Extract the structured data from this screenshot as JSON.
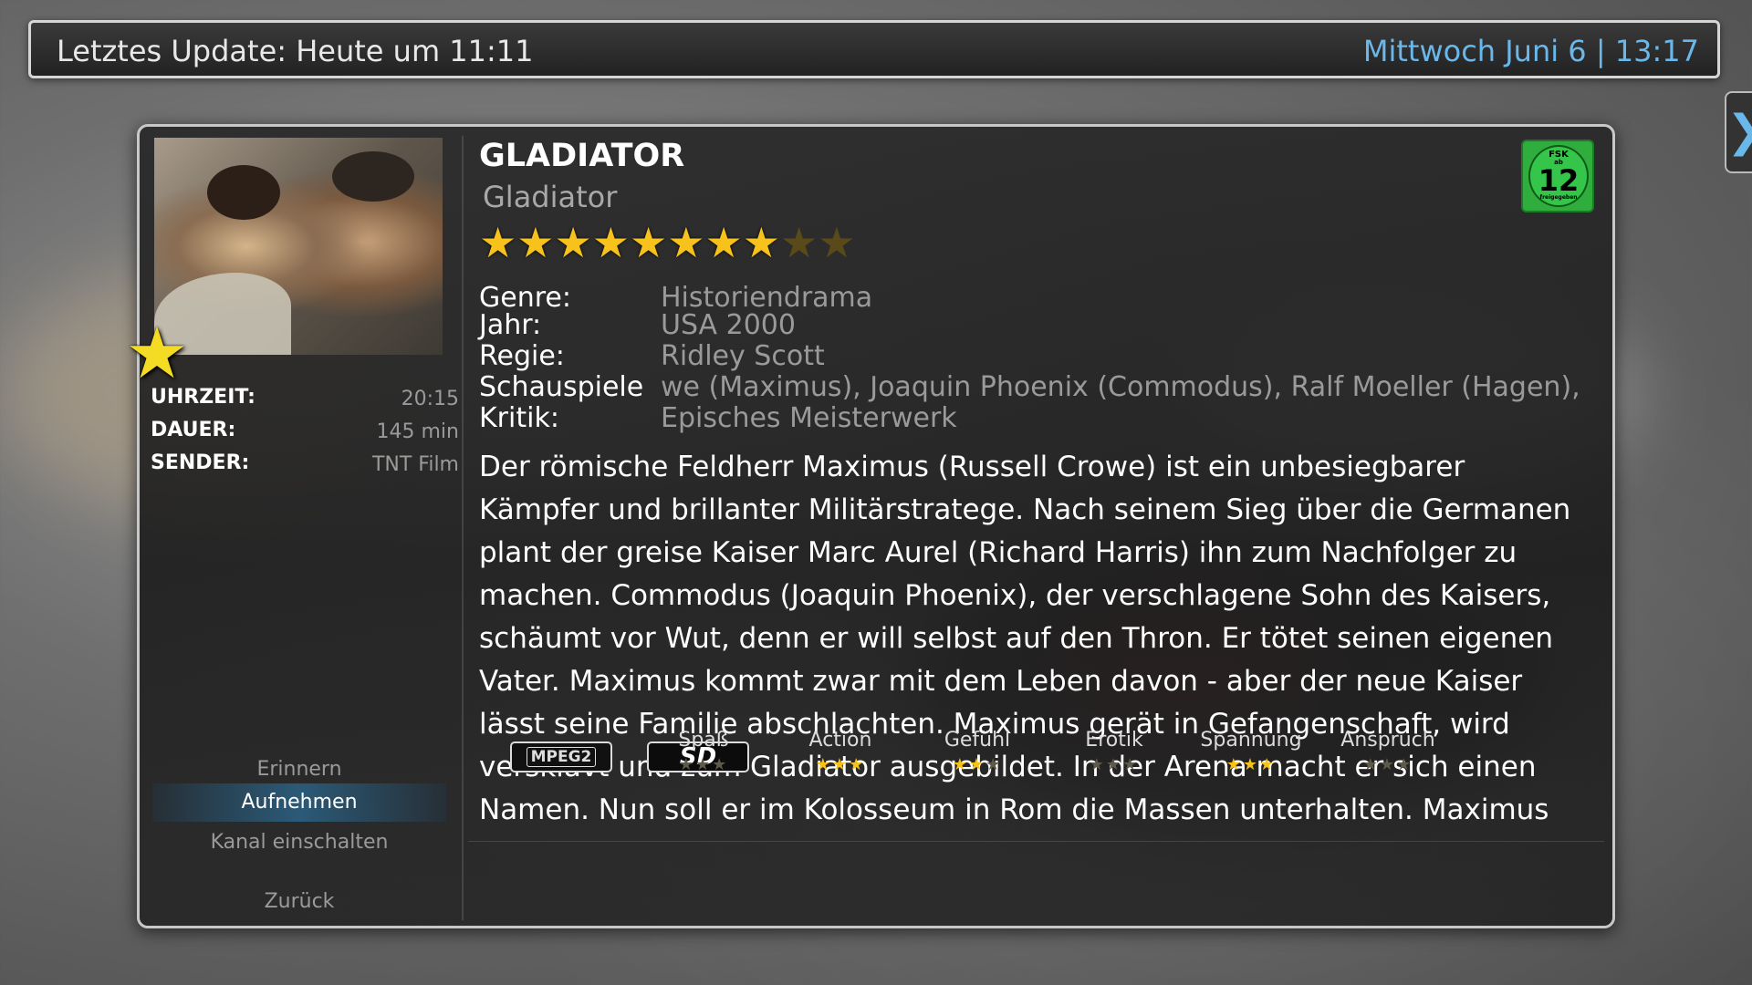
{
  "header": {
    "last_update": "Letztes Update: Heute um 11:11",
    "datetime": "Mittwoch Juni 6 | 13:17"
  },
  "side_tab": {
    "glyph": "❯"
  },
  "movie": {
    "title": "GLADIATOR",
    "original_title": "Gladiator",
    "stars_filled": 8,
    "stars_total": 10,
    "fsk": {
      "top": "FSK",
      "ab": "ab",
      "age": "12",
      "bottom": "freigegeben"
    }
  },
  "broadcast": {
    "time_label": "UHRZEIT:",
    "time_value": "20:15",
    "duration_label": "DAUER:",
    "duration_value": "145 min",
    "channel_label": "SENDER:",
    "channel_value": "TNT Film"
  },
  "meta": {
    "genre_label": "Genre:",
    "genre_value": "Historiendrama",
    "year_label": "Jahr:",
    "year_value": "USA 2000",
    "director_label": "Regie:",
    "director_value": "Ridley Scott",
    "cast_label": "Schauspiele",
    "cast_value": "we (Maximus), Joaquin Phoenix (Commodus), Ralf Moeller (Hagen),",
    "critic_label": "Kritik:",
    "critic_value": "Episches Meisterwerk"
  },
  "description": "Der römische Feldherr Maximus (Russell Crowe) ist ein unbesiegbarer Kämpfer und brillanter Militärstratege. Nach seinem Sieg über die Germanen plant der greise Kaiser Marc Aurel (Richard Harris) ihn zum Nachfolger zu machen. Commodus (Joaquin Phoenix), der verschlagene Sohn des Kaisers, schäumt vor Wut, denn er will selbst auf den Thron. Er tötet seinen eigenen Vater. Maximus kommt zwar mit dem Leben davon - aber der neue Kaiser lässt seine Familie abschlachten. Maximus gerät in Gefangenschaft, wird versklavt und zum Gladiator ausgebildet. In der Arena macht er sich einen Namen. Nun soll er im Kolosseum in Rom die Massen unterhalten. Maximus",
  "menu": {
    "remind": "Erinnern",
    "record": "Aufnehmen",
    "switch_channel": "Kanal einschalten",
    "back": "Zurück"
  },
  "badges": {
    "codec": "MPEG2",
    "resolution": "SD"
  },
  "ratings": [
    {
      "label": "Spaß",
      "value": 0,
      "max": 3
    },
    {
      "label": "Action",
      "value": 3,
      "max": 3
    },
    {
      "label": "Gefühl",
      "value": 2,
      "max": 3
    },
    {
      "label": "Erotik",
      "value": 0,
      "max": 3
    },
    {
      "label": "Spannung",
      "value": 3,
      "max": 3
    },
    {
      "label": "Anspruch",
      "value": 0,
      "max": 3
    }
  ]
}
